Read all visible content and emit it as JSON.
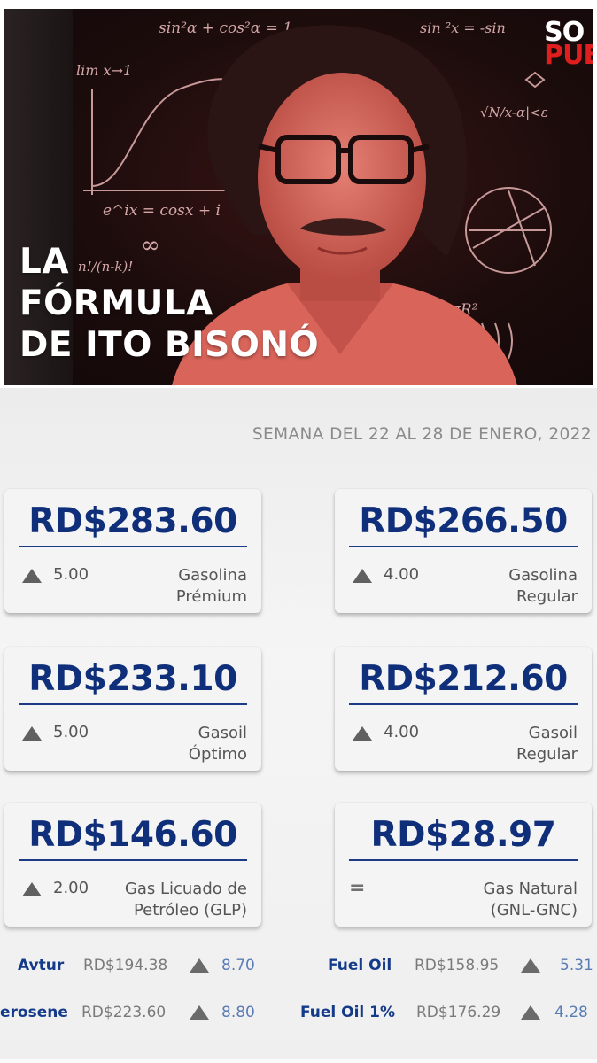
{
  "banner": {
    "headline_lines": [
      "LA",
      "FÓRMULA",
      "DE ITO BISONÓ"
    ],
    "logo_lines": [
      "SO",
      "PUE"
    ],
    "formulas": [
      "sin²α + cos²α = 1",
      "sin ²x = -sin",
      "lim x→1",
      "e^ix = cosx + i",
      "n!/(n-k)!",
      "S=4πR²",
      "∞",
      "√N/x-α|<ε"
    ]
  },
  "week_label": "SEMANA DEL 22 AL 28 DE ENERO, 2022",
  "cards": [
    {
      "price": "RD$283.60",
      "indicator": "up",
      "change": "5.00",
      "label_lines": [
        "Gasolina",
        "Prémium"
      ]
    },
    {
      "price": "RD$266.50",
      "indicator": "up",
      "change": "4.00",
      "label_lines": [
        "Gasolina",
        "Regular"
      ]
    },
    {
      "price": "RD$233.10",
      "indicator": "up",
      "change": "5.00",
      "label_lines": [
        "Gasoil",
        "Óptimo"
      ]
    },
    {
      "price": "RD$212.60",
      "indicator": "up",
      "change": "4.00",
      "label_lines": [
        "Gasoil",
        "Regular"
      ]
    },
    {
      "price": "RD$146.60",
      "indicator": "up",
      "change": "2.00",
      "label_lines": [
        "Gas Licuado de",
        "Petróleo (GLP)"
      ]
    },
    {
      "price": "RD$28.97",
      "indicator": "equal",
      "change": "=",
      "label_lines": [
        "Gas Natural",
        "(GNL-GNC)"
      ]
    }
  ],
  "rows": [
    {
      "name": "Avtur",
      "price": "RD$194.38",
      "change": "8.70"
    },
    {
      "name": "Fuel Oil",
      "price": "RD$158.95",
      "change": "5.31"
    },
    {
      "name": "erosene",
      "price": "RD$223.60",
      "change": "8.80"
    },
    {
      "name": "Fuel Oil 1%",
      "price": "RD$176.29",
      "change": "4.28"
    }
  ],
  "colors": {
    "price_blue": "#0f2f7a",
    "banner_red": "#d9534f",
    "change_blue": "#5a7cb6"
  }
}
